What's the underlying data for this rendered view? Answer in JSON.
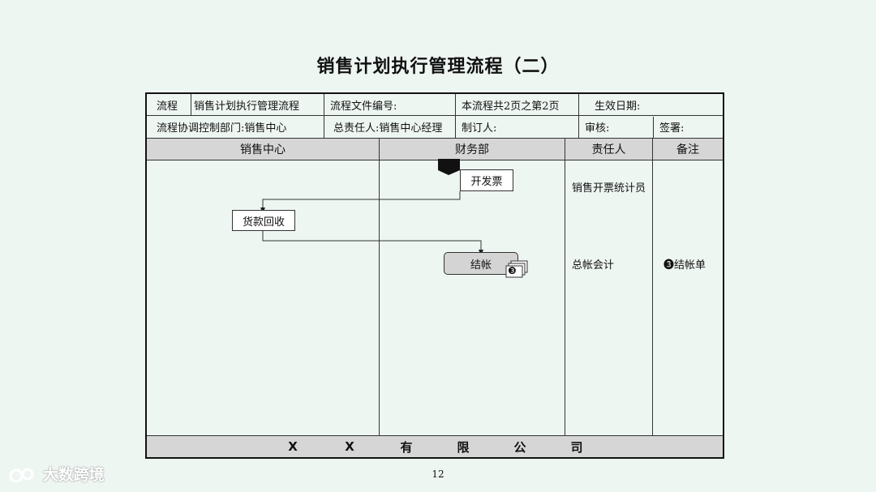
{
  "title": "销售计划执行管理流程（二）",
  "header": {
    "row1": {
      "c1": "流程",
      "c2": "销售计划执行管理流程",
      "c3": "流程文件编号:",
      "c4": "本流程共2页之第2页",
      "c5": "生效日期:"
    },
    "row2": {
      "c1": "流程协调控制部门:销售中心",
      "c2": "总责任人:销售中心经理",
      "c3": "制订人:",
      "c4": "审核:",
      "c5": "签署:"
    }
  },
  "lanes": {
    "sales": "销售中心",
    "finance": "财务部",
    "responsible": "责任人",
    "remarks": "备注"
  },
  "nodes": {
    "invoice": "开发票",
    "collection": "货款回收",
    "settle": "结帐",
    "settle_doc_badge": "❸"
  },
  "responsible": {
    "invoice": "销售开票统计员",
    "settle": "总帐会计"
  },
  "remarks": {
    "settle": "❸结帐单"
  },
  "footer": [
    "X",
    "X",
    "有",
    "限",
    "公",
    "司"
  ],
  "page_number": "12",
  "watermark": "大数跨境"
}
